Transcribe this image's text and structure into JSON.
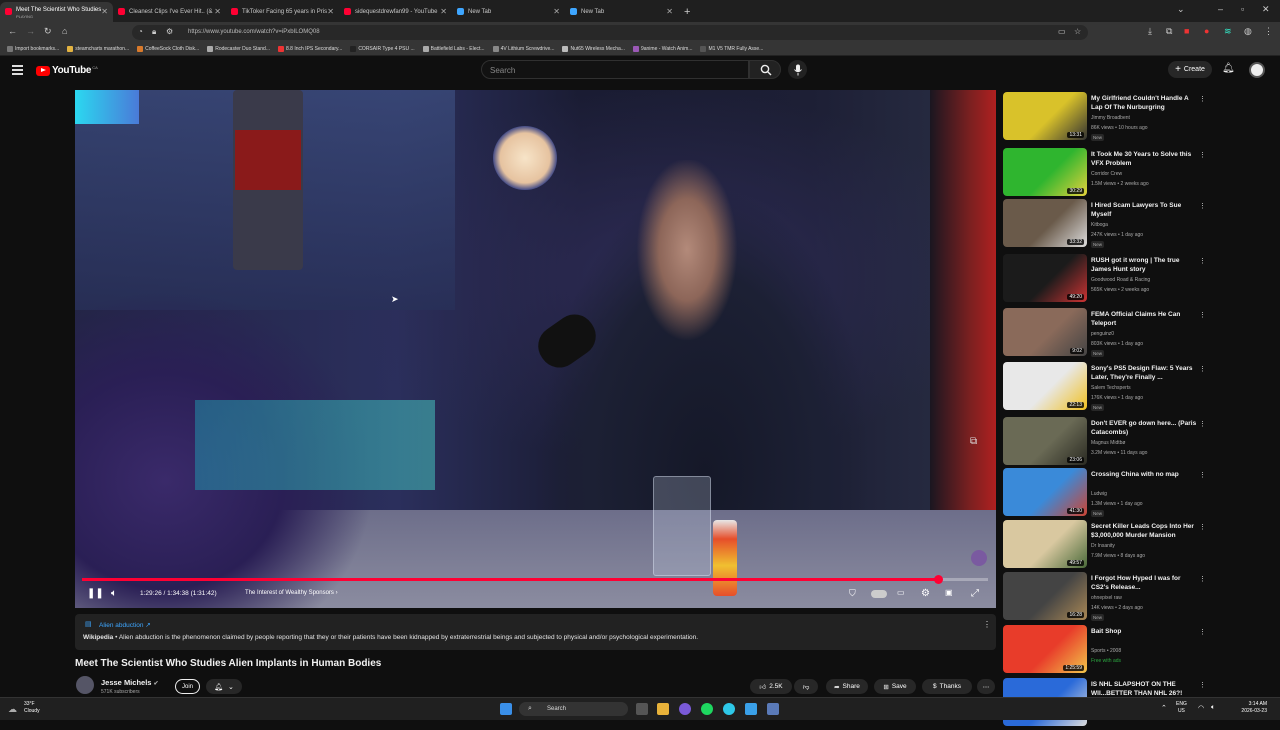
{
  "browser": {
    "tabs": [
      {
        "title": "Meet The Scientist Who Studies",
        "sub": "PLAYING",
        "active": true,
        "icon_color": "#ff0033"
      },
      {
        "title": "Cleanest Clips I've Ever Hit.. (& ",
        "icon_color": "#ff0033"
      },
      {
        "title": "TikToker Facing 65 years in Pris",
        "icon_color": "#ff0033"
      },
      {
        "title": "sidequestdrewfan99 - YouTube",
        "icon_color": "#ff0033"
      },
      {
        "title": "New Tab",
        "icon_color": "#3ea6ff"
      },
      {
        "title": "New Tab",
        "icon_color": "#3ea6ff"
      }
    ],
    "new_tab_symbol": "+",
    "url": "https://www.youtube.com/watch?v=iPxbILOMQ08",
    "bookmarks": [
      {
        "label": "Import bookmarks...",
        "color": "#777"
      },
      {
        "label": "steamcharts marathon...",
        "color": "#e3b341"
      },
      {
        "label": "CoffeeSock Cloth Disk...",
        "color": "#d97a2b"
      },
      {
        "label": "Rodecaster Duo Stand...",
        "color": "#aaa"
      },
      {
        "label": "8.8 Inch IPS Secondary...",
        "color": "#e33"
      },
      {
        "label": "CORSAIR Type 4 PSU ...",
        "color": "#222"
      },
      {
        "label": "Battlefield Labs - Elect...",
        "color": "#aaa"
      },
      {
        "label": "4V Lithium Screwdrive...",
        "color": "#888"
      },
      {
        "label": "Nut65 Wireless Mecha...",
        "color": "#bbb"
      },
      {
        "label": "9anime - Watch Anim...",
        "color": "#9b59b6"
      },
      {
        "label": "M1 V5 TMR Fully Asse...",
        "color": "#555"
      }
    ]
  },
  "yt": {
    "logo_text": "YouTube",
    "logo_country": "CA",
    "search_placeholder": "Search",
    "create_label": "Create"
  },
  "player": {
    "time": "1:29:26 / 1:34:38 (1:31:42)",
    "chapter": "The Interest of Wealthy Sponsors",
    "progress_fraction": 0.945
  },
  "info_panel": {
    "title": "Alien abduction",
    "source": "Wikipedia",
    "text": " • Alien abduction is the phenomenon claimed by people reporting that they or their patients have been kidnapped by extraterrestrial beings and subjected to physical and/or psychological experimentation."
  },
  "video": {
    "title": "Meet The Scientist Who Studies Alien Implants in Human Bodies",
    "channel": "Jesse Michels",
    "subscribers": "571K subscribers",
    "join_label": "Join",
    "likes": "2.5K",
    "share_label": "Share",
    "save_label": "Save",
    "thanks_label": "Thanks"
  },
  "recommendations": [
    {
      "title": "My Girlfriend Couldn't Handle A Lap Of The Nurburgring",
      "channel": "Jimmy Broadbent",
      "meta": "86K views • 10 hours ago",
      "badge": "New",
      "duration": "13:31",
      "thumb_color": "#d9c22a",
      "thumb_color2": "#333"
    },
    {
      "title": "It Took Me 30 Years to Solve this VFX Problem",
      "channel": "Corridor Crew",
      "meta": "1.5M views • 2 weeks ago",
      "badge": "",
      "duration": "30:29",
      "thumb_color": "#2fb52f",
      "thumb_color2": "#e5d23c"
    },
    {
      "title": "I Hired Scam Lawyers To Sue Myself",
      "channel": "Kitboga",
      "meta": "247K views • 1 day ago",
      "badge": "New",
      "duration": "33:32",
      "thumb_color": "#6a5a4a",
      "thumb_color2": "#ddd"
    },
    {
      "title": "RUSH got it wrong | The true James Hunt story",
      "channel": "Goodwood Road & Racing",
      "meta": "565K views • 2 weeks ago",
      "badge": "",
      "duration": "49:20",
      "thumb_color": "#1b1b1b",
      "thumb_color2": "#c33"
    },
    {
      "title": "FEMA Official Claims He Can Teleport",
      "channel": "penguinz0",
      "meta": "803K views • 1 day ago",
      "badge": "New",
      "duration": "9:02",
      "thumb_color": "#8a6a5a",
      "thumb_color2": "#444"
    },
    {
      "title": "Sony's PS5 Design Flaw: 5 Years Later, They're Finally ...",
      "channel": "Salem Techsperts",
      "meta": "176K views • 1 day ago",
      "badge": "New",
      "duration": "22:13",
      "thumb_color": "#e8e8e8",
      "thumb_color2": "#f0c020"
    },
    {
      "title": "Don't EVER go down here... (Paris Catacombs)",
      "channel": "Magnus Midtbø",
      "meta": "3.2M views • 11 days ago",
      "badge": "",
      "duration": "23:06",
      "thumb_color": "#6a6a55",
      "thumb_color2": "#2a2a22"
    },
    {
      "title": "Crossing China with no map",
      "channel": "Ludwig",
      "meta": "1.3M views • 1 day ago",
      "badge": "New",
      "duration": "41:30",
      "thumb_color": "#3a8ad9",
      "thumb_color2": "#c43"
    },
    {
      "title": "Secret Killer Leads Cops Into Her $3,000,000 Murder Mansion",
      "channel": "Dr Insanity",
      "meta": "7.9M views • 8 days ago",
      "badge": "",
      "duration": "49:57",
      "thumb_color": "#d9c8a0",
      "thumb_color2": "#4a6a3a"
    },
    {
      "title": "I Forgot How Hyped I was for CS2's Release...",
      "channel": "ohnepixel raw",
      "meta": "14K views • 2 days ago",
      "badge": "New",
      "duration": "16:28",
      "thumb_color": "#444",
      "thumb_color2": "#aa8855"
    },
    {
      "title": "Bait Shop",
      "channel": "Sports • 2008",
      "meta": "Free with ads",
      "badge": "",
      "duration": "1:25:59",
      "thumb_color": "#e83c2a",
      "thumb_color2": "#f2c64a"
    },
    {
      "title": "IS NHL SLAPSHOT ON THE WII...BETTER THAN NHL 26?!",
      "channel": "",
      "meta": "",
      "badge": "",
      "duration": "",
      "thumb_color": "#2a6ad9",
      "thumb_color2": "#ddd"
    }
  ],
  "taskbar": {
    "weather_temp": "33°F",
    "weather_desc": "Cloudy",
    "search_label": "Search",
    "lang": "ENG",
    "region": "US",
    "time": "3:14 AM",
    "date": "2026-03-23"
  }
}
